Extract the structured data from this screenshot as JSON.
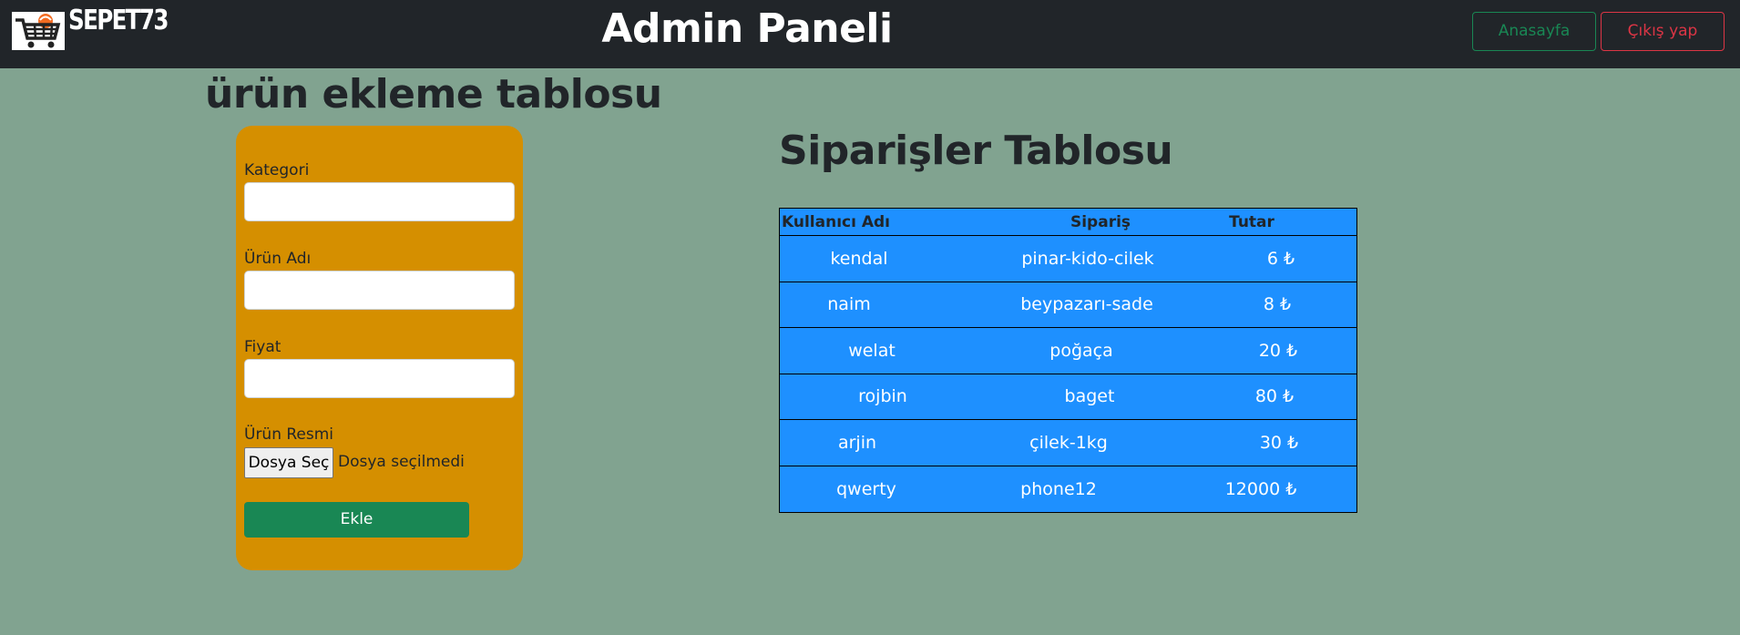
{
  "header": {
    "brand": "SEPET73",
    "title": "Admin Paneli",
    "home_button": "Anasayfa",
    "logout_button": "Çıkış yap",
    "logo_icon": "shopping-cart-icon"
  },
  "form": {
    "title": "ürün ekleme tablosu",
    "category_label": "Kategori",
    "category_value": "",
    "product_name_label": "Ürün Adı",
    "product_name_value": "",
    "price_label": "Fiyat",
    "price_value": "",
    "image_label": "Ürün Resmi",
    "file_button": "Dosya Seç",
    "file_status": "Dosya seçilmedi",
    "submit_button": "Ekle"
  },
  "orders": {
    "title": "Siparişler Tablosu",
    "columns": [
      "Kullanıcı Adı",
      "Sipariş",
      "Tutar"
    ],
    "rows": [
      {
        "user": "kendal",
        "order": "pinar-kido-cilek",
        "amount": "6 ₺"
      },
      {
        "user": "naim",
        "order": "beypazarı-sade",
        "amount": "8 ₺"
      },
      {
        "user": "welat",
        "order": "poğaça",
        "amount": "20 ₺"
      },
      {
        "user": "rojbin",
        "order": "baget",
        "amount": "80 ₺"
      },
      {
        "user": "arjin",
        "order": "çilek-1kg",
        "amount": "30 ₺"
      },
      {
        "user": "qwerty",
        "order": "phone12",
        "amount": "12000 ₺"
      }
    ]
  },
  "colors": {
    "navbar": "#212529",
    "page_background": "#81a390",
    "form_card": "#d58f00",
    "table_background": "#1e90ff",
    "success": "#198754",
    "danger": "#dc3545"
  }
}
